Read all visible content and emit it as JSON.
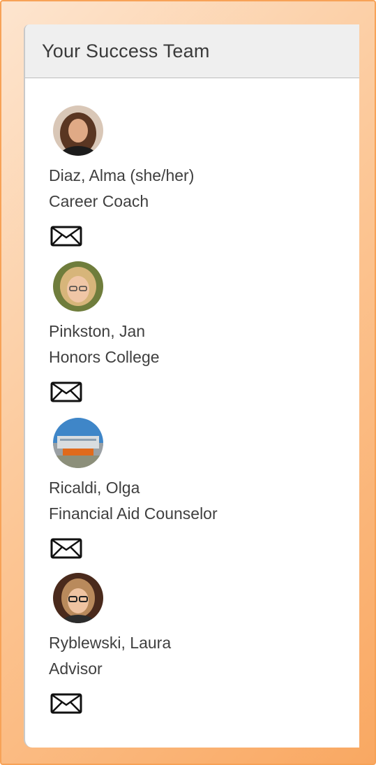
{
  "panel": {
    "title": "Your Success Team"
  },
  "members": [
    {
      "name": "Diaz, Alma (she/her)",
      "role": "Career Coach",
      "avatar": "photo-woman-dark-hair",
      "contact_icon": "mail-icon"
    },
    {
      "name": "Pinkston, Jan",
      "role": "Honors College",
      "avatar": "photo-woman-blonde-glasses",
      "contact_icon": "mail-icon"
    },
    {
      "name": "Ricaldi, Olga",
      "role": "Financial Aid Counselor",
      "avatar": "photo-campus-building",
      "contact_icon": "mail-icon"
    },
    {
      "name": "Ryblewski, Laura",
      "role": "Advisor",
      "avatar": "photo-woman-glasses",
      "contact_icon": "mail-icon"
    }
  ],
  "colors": {
    "frame_border": "#f7a257",
    "header_bg": "#efefef",
    "text": "#3f3f3f"
  }
}
